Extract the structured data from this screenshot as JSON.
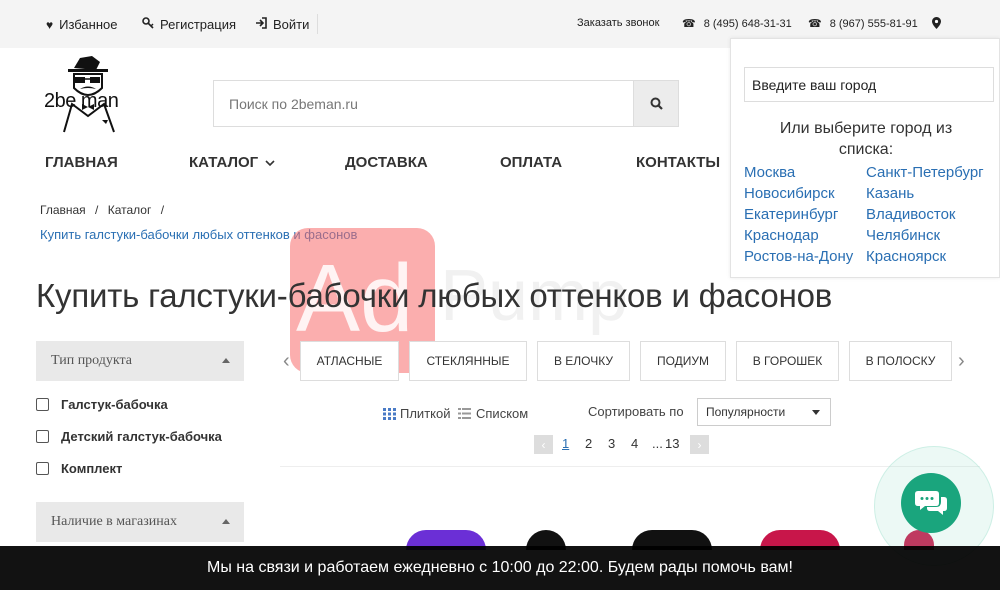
{
  "topbar": {
    "favorites": "Избанное",
    "register": "Регистрация",
    "login": "Войти",
    "callback": "Заказать звонок",
    "phone1": "8 (495) 648-31-31",
    "phone2": "8 (967) 555-81-91"
  },
  "logo": {
    "text": "2be  man"
  },
  "search": {
    "placeholder": "Поиск по 2beman.ru"
  },
  "nav": {
    "home": "ГЛАВНАЯ",
    "catalog": "КАТАЛОГ",
    "delivery": "ДОСТАВКА",
    "payment": "ОПЛАТА",
    "contacts": "КОНТАКТЫ"
  },
  "breadcrumb": {
    "home": "Главная",
    "catalog": "Каталог",
    "sep": "/",
    "current": "Купить галстуки-бабочки любых оттенков и фасонов"
  },
  "page_title": "Купить галстуки-бабочки любых оттенков и фасонов",
  "filters": {
    "product_type": {
      "title": "Тип продукта",
      "options": [
        "Галстук-бабочка",
        "Детский галстук-бабочка",
        "Комплект"
      ]
    },
    "availability": {
      "title": "Наличие в магазинах"
    }
  },
  "tags": [
    "АТЛАСНЫЕ",
    "СТЕКЛЯННЫЕ",
    "В ЕЛОЧКУ",
    "ПОДИУМ",
    "В ГОРОШЕК",
    "В ПОЛОСКУ"
  ],
  "view": {
    "tiles": "Плиткой",
    "list": "Списком"
  },
  "sort": {
    "label": "Сортировать по",
    "selected": "Популярности"
  },
  "pagination": {
    "pages": [
      "1",
      "2",
      "3",
      "4"
    ],
    "ellipsis": "...",
    "last": "13",
    "current": "1"
  },
  "city": {
    "input_placeholder": "Введите ваш город",
    "prompt": "Или выберите город из списка:",
    "left": [
      "Москва",
      "Новосибирск",
      "Екатеринбург",
      "Краснодар",
      "Ростов-на-Дону"
    ],
    "right": [
      "Санкт-Петербург",
      "Казань",
      "Владивосток",
      "Челябинск",
      "Красноярск"
    ]
  },
  "watermark": {
    "text": "Ad",
    "text2": "Pump"
  },
  "banner": "Мы на связи и работаем ежедневно с 10:00 до 22:00. Будем рады помочь вам!",
  "colors": {
    "accent": "#2a6fb3",
    "chat": "#1aa57d",
    "watermark": "#f76b6b"
  }
}
